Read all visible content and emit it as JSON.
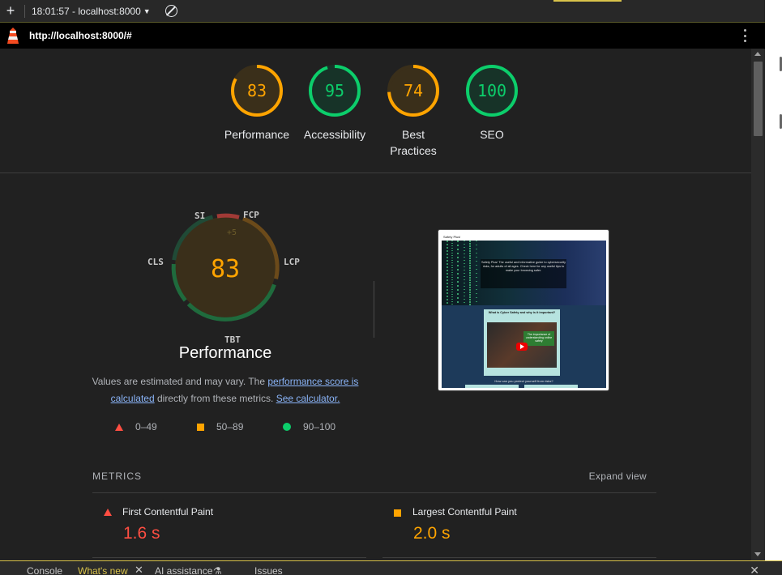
{
  "toolbar": {
    "add_icon": "plus-icon",
    "session": "18:01:57 - localhost:8000",
    "block_icon": "block-icon"
  },
  "url_bar": {
    "logo": "lighthouse-icon",
    "url": "http://localhost:8000/#",
    "menu_icon": "kebab-icon"
  },
  "categories": [
    {
      "label": "Performance",
      "score": 83,
      "color": "#ffa400",
      "bg": "#3a2f1a"
    },
    {
      "label": "Accessibility",
      "score": 95,
      "color": "#0cce6b",
      "bg": "#173328"
    },
    {
      "label": "Best Practices",
      "score": 74,
      "color": "#ffa400",
      "bg": "#3a2f1a"
    },
    {
      "label": "SEO",
      "score": 100,
      "color": "#0cce6b",
      "bg": "#173328"
    }
  ],
  "performance": {
    "score": 83,
    "title": "Performance",
    "labels": {
      "si": "SI",
      "fcp": "FCP",
      "lcp": "LCP",
      "tbt": "TBT",
      "cls": "CLS"
    },
    "fcp_delta": "+5",
    "desc_before": "Values are estimated and may vary. The ",
    "desc_link1": "performance score is calculated",
    "desc_middle": " directly from these metrics. ",
    "desc_link2": "See calculator."
  },
  "legend": {
    "fail": "0–49",
    "average": "50–89",
    "pass": "90–100"
  },
  "screenshot": {
    "site_title": "Safety Plus!",
    "hero_text": "Safety Plus! The useful and informative guide to cybersecurity risks, for adults of all ages. Check here for any useful tips to make your browsing safer.",
    "panel_title": "What is Cyber Safety and why is it important?",
    "video_title": "The importance of understanding online safety",
    "bottom_text": "How can you protect yourself from risks?"
  },
  "metrics": {
    "title": "METRICS",
    "expand": "Expand view",
    "items": [
      {
        "name": "First Contentful Paint",
        "value": "1.6 s",
        "status": "fail",
        "color": "#ff4e42"
      },
      {
        "name": "Largest Contentful Paint",
        "value": "2.0 s",
        "status": "average",
        "color": "#ffa400"
      }
    ]
  },
  "drawer": {
    "tabs": [
      "Console",
      "What's new",
      "AI assistance",
      "Issues"
    ],
    "active": "What's new",
    "close_icon": "close-icon"
  },
  "colors": {
    "pass": "#0cce6b",
    "average": "#ffa400",
    "fail": "#ff4e42",
    "link": "#8ab4f8"
  }
}
